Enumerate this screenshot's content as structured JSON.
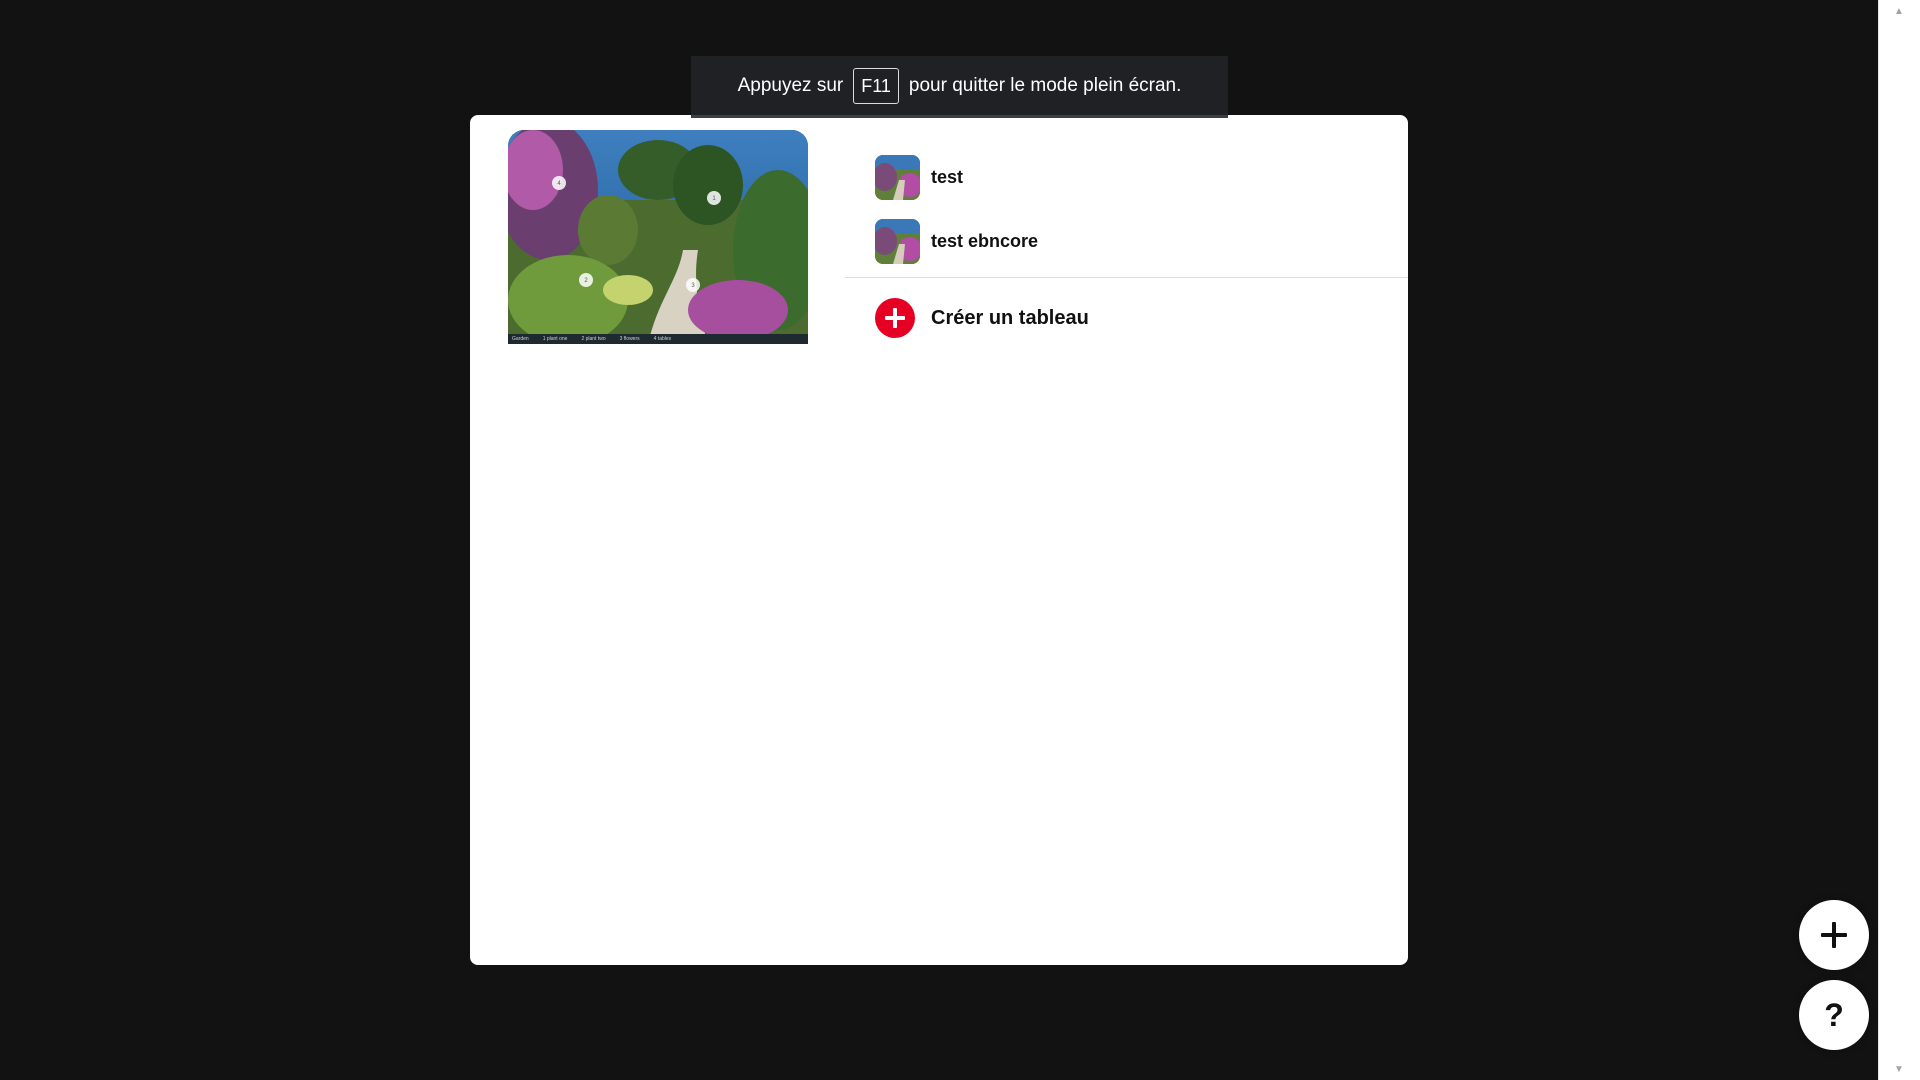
{
  "fullscreen_toast": {
    "prefix": "Appuyez sur",
    "key": "F11",
    "suffix": "pour quitter le mode plein écran."
  },
  "pin_preview": {
    "footer_labels": [
      "Garden",
      "1 plant one",
      "2 plant two",
      "3 flowers",
      "4 tables"
    ],
    "markers": [
      "1",
      "2",
      "3",
      "4"
    ]
  },
  "boards": [
    {
      "name": "test"
    },
    {
      "name": "test ebncore"
    }
  ],
  "create_board": {
    "label": "Créer un tableau"
  },
  "fab": {
    "add_icon": "plus-icon",
    "help_label": "?"
  },
  "colors": {
    "background": "#121212",
    "accent_red": "#e60023",
    "toast_bg": "#202124"
  }
}
